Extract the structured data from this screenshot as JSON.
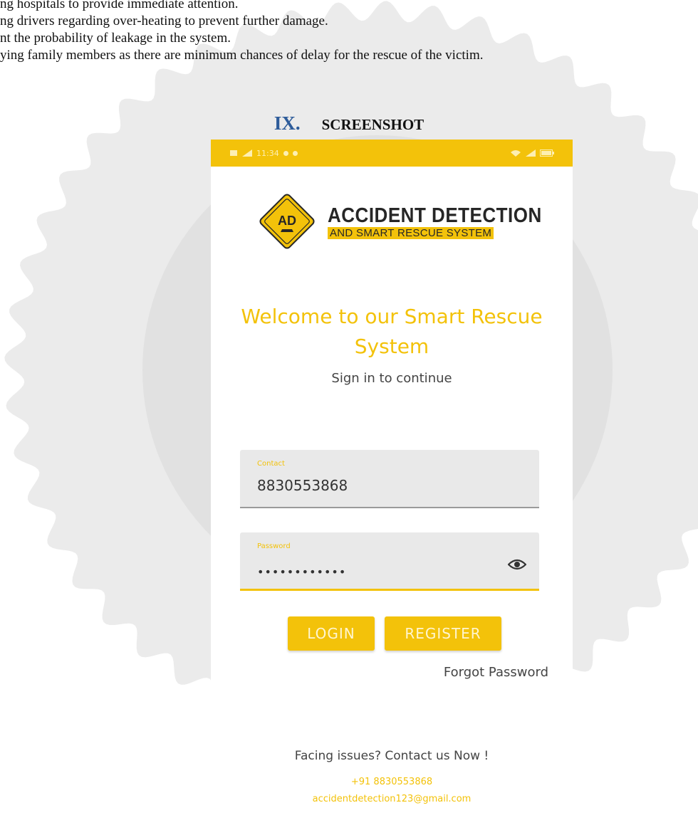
{
  "document": {
    "lines": [
      "ng hospitals to provide immediate attention.",
      "ng drivers regarding over-heating to prevent further damage.",
      "nt the probability of leakage in the system.",
      "ying family members as there are minimum chances of delay for the rescue of the victim."
    ],
    "section_number": "IX.",
    "section_title": "SCREENSHOT"
  },
  "app": {
    "status_bar": {
      "time": "11:34"
    },
    "logo": {
      "sign_letters": "AD",
      "title": "ACCIDENT DETECTION",
      "subtitle": "AND SMART RESCUE SYSTEM"
    },
    "welcome": {
      "line1": "Welcome to our Smart Rescue",
      "line2": "System"
    },
    "signin_text": "Sign in to continue",
    "contact_field": {
      "label": "Contact",
      "value": "8830553868"
    },
    "password_field": {
      "label": "Password",
      "value": "••••••••••••",
      "icon": "eye-icon"
    },
    "buttons": {
      "login": "LOGIN",
      "register": "REGISTER"
    },
    "forgot_password": "Forgot Password",
    "footer": {
      "issues": "Facing issues? Contact us Now !",
      "phone": "+91 8830553868",
      "email": "accidentdetection123@gmail.com"
    },
    "colors": {
      "accent": "#f3c20a",
      "field_bg": "#e9e9e9",
      "text": "#444444"
    }
  }
}
